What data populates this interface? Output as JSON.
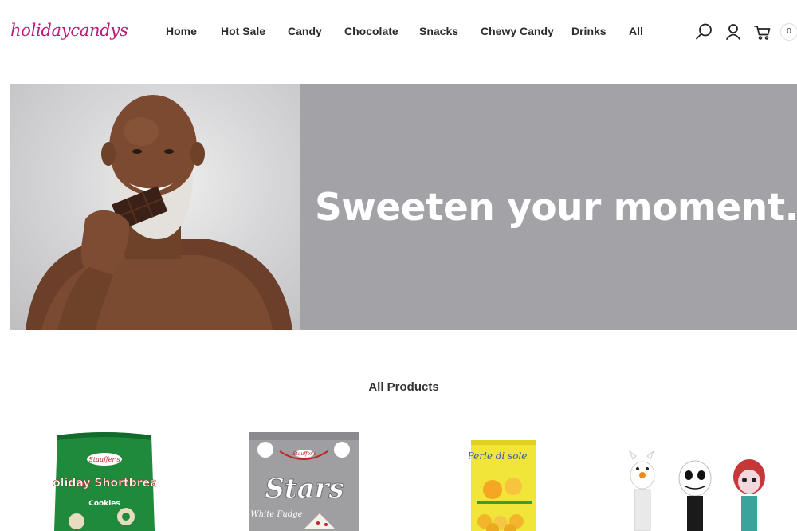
{
  "header": {
    "logo_text": "holidaycandys",
    "nav": [
      {
        "label": "Home"
      },
      {
        "label": "Hot Sale"
      },
      {
        "label": "Candy"
      },
      {
        "label": "Chocolate"
      },
      {
        "label": "Snacks"
      },
      {
        "label": "Chewy Candy"
      },
      {
        "label": "Drinks"
      },
      {
        "label": "All"
      }
    ],
    "icons": {
      "search": "search-icon",
      "account": "user-icon",
      "cart": "cart-icon"
    },
    "cart_count": "0"
  },
  "hero": {
    "headline": "Sweeten your moment.",
    "background_color": "#a3a2a7"
  },
  "products_section": {
    "title": "All Products",
    "products": [
      {
        "name_on_pack": "Holiday Shortbread",
        "sub_on_pack": "Cookies",
        "brand": "Stauffer's"
      },
      {
        "name_on_pack": "Stars",
        "sub_on_pack": "White Fudge",
        "brand": "Stauffer's"
      },
      {
        "name_on_pack": "Perle di sole",
        "brand": "Perle di sole"
      },
      {
        "name_on_pack": "PEZ dispensers"
      }
    ]
  },
  "colors": {
    "brand": "#c2187a",
    "nav_text": "#2a2a2a"
  }
}
